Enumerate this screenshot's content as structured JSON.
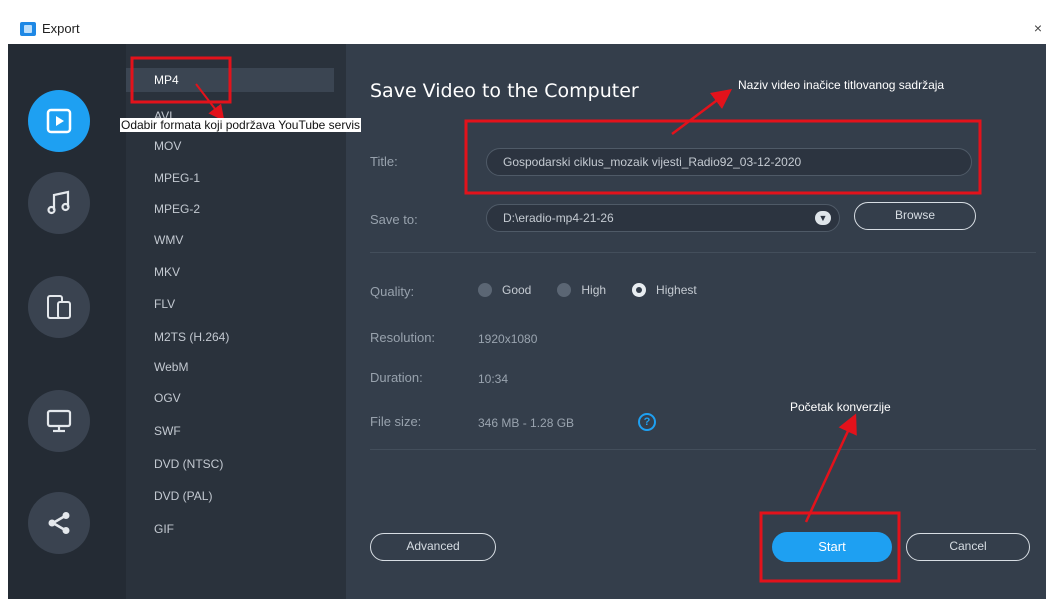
{
  "window": {
    "title": "Export",
    "close_glyph": "×",
    "icon": "app-icon"
  },
  "rail": [
    {
      "name": "video",
      "icon": "video-file-icon",
      "active": true
    },
    {
      "name": "audio",
      "icon": "music-note-icon",
      "active": false
    },
    {
      "name": "devices",
      "icon": "devices-icon",
      "active": false
    },
    {
      "name": "tv",
      "icon": "monitor-icon",
      "active": false
    },
    {
      "name": "share",
      "icon": "share-icon",
      "active": false
    }
  ],
  "formats": [
    "MP4",
    "AVI",
    "MOV",
    "MPEG-1",
    "MPEG-2",
    "WMV",
    "MKV",
    "FLV",
    "M2TS (H.264)",
    "WebM",
    "OGV",
    "SWF",
    "DVD (NTSC)",
    "DVD (PAL)",
    "GIF"
  ],
  "selected_format": "MP4",
  "main": {
    "heading": "Save Video to the Computer",
    "title_label": "Title:",
    "title_value": "Gospodarski ciklus_mozaik vijesti_Radio92_03-12-2020",
    "save_label": "Save to:",
    "save_value": "D:\\eradio-mp4-21-26",
    "browse": "Browse",
    "quality_label": "Quality:",
    "quality_options": [
      "Good",
      "High",
      "Highest"
    ],
    "quality_selected": "Highest",
    "resolution_label": "Resolution:",
    "resolution_value": "1920x1080",
    "duration_label": "Duration:",
    "duration_value": "10:34",
    "filesize_label": "File size:",
    "filesize_value": "346 MB - 1.28 GB",
    "advanced": "Advanced",
    "start": "Start",
    "cancel": "Cancel"
  },
  "annotations": {
    "format_note": "Odabir formata koji podržava YouTube servis",
    "title_note": "Naziv video inačice titlovanog sadržaja",
    "start_note": "Početak konverzije"
  },
  "colors": {
    "accent": "#1ea0f2",
    "annotation": "#e3121b",
    "panel": "#343e4b",
    "rail": "#242b34"
  }
}
